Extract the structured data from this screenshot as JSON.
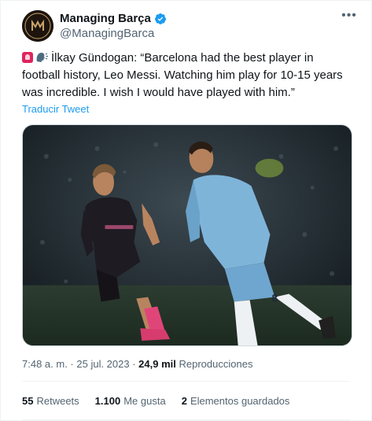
{
  "author": {
    "display_name": "Managing Barça",
    "handle": "@ManagingBarca",
    "avatar_icon": "managing-barca-logo",
    "verified_color": "#1d9bf0"
  },
  "tweet": {
    "text": "İlkay Gündogan: “Barcelona had the best player in football history, Leo Messi. Watching him play for 10-15 years was incredible. I wish I would have played with him.”",
    "leading_emojis": [
      "siren-emoji",
      "speaking-head-emoji"
    ],
    "translate_label": "Traducir Tweet"
  },
  "media": {
    "description_icon": "football-match-photo"
  },
  "meta": {
    "time": "7:48 a. m.",
    "separator": " · ",
    "date": "25 jul. 2023",
    "views_count": "24,9 mil",
    "views_label": "Reproducciones"
  },
  "stats": {
    "retweets_count": "55",
    "retweets_label": "Retweets",
    "likes_count": "1.100",
    "likes_label": "Me gusta",
    "bookmarks_count": "2",
    "bookmarks_label": "Elementos guardados"
  },
  "colors": {
    "link": "#1d9bf0",
    "secondary_text": "#536471",
    "primary_text": "#0f1419"
  }
}
